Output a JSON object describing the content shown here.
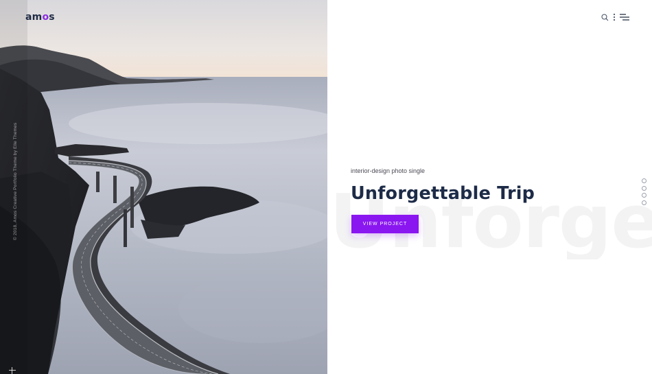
{
  "brand": {
    "logo_prefix": "am",
    "logo_accent": "o",
    "logo_suffix": "s",
    "accent_color": "#8a2be2"
  },
  "header": {
    "icons": [
      "search-icon",
      "more-vertical-icon",
      "menu-icon"
    ]
  },
  "sidebar": {
    "credit": "© 2018, Amos Creative Portfolio Theme by Elle Themes"
  },
  "hero": {
    "category": "interior-design photo single",
    "title": "Unforgettable Trip",
    "background_word": "Unforgett",
    "button_label": "VIEW PROJECT",
    "button_color": "#8a16f0"
  },
  "pagination": {
    "count": 5,
    "active_index": 0
  },
  "colors": {
    "title": "#1d2b47",
    "background": "#ffffff"
  }
}
